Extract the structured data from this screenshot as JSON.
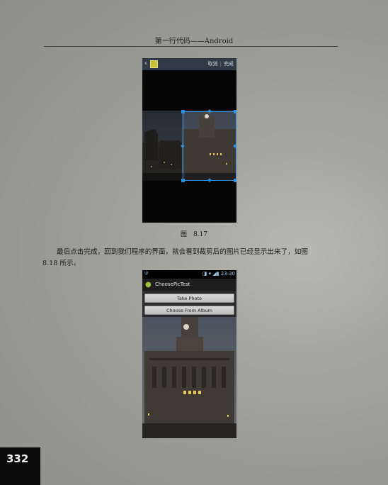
{
  "header": {
    "title": "第一行代码——Android"
  },
  "figure1": {
    "back_glyph": "‹",
    "cancel_label": "取消",
    "separator": "|",
    "done_label": "完成",
    "caption": "图　8.17"
  },
  "paragraph": {
    "line1": "最后点击完成，回到我们程序的界面，就会看到裁剪后的图片已经显示出来了，如图",
    "line2": "8.18 所示。"
  },
  "figure2": {
    "status_icons_left": "Ψ",
    "status_time": "23:30",
    "app_title": "ChoosePicTest",
    "take_photo_label": "Take Photo",
    "choose_album_label": "Choose From Album"
  },
  "page_number": "332",
  "colors": {
    "crop_accent": "#2f8ee0",
    "android_green": "#9ac43d"
  }
}
